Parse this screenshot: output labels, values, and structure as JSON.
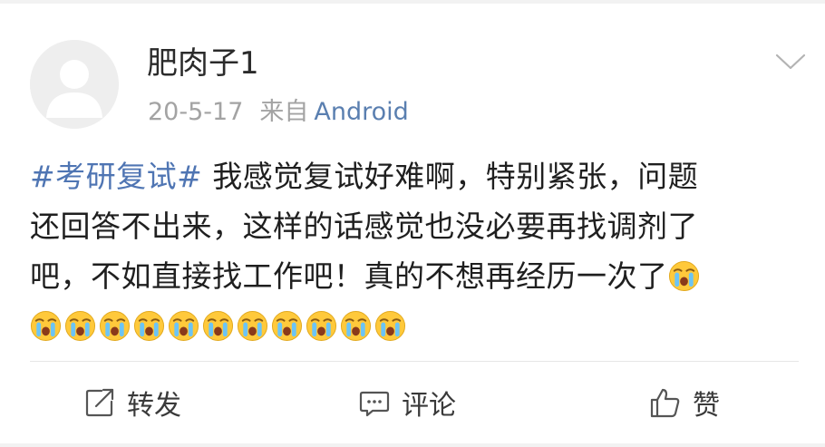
{
  "post": {
    "username": "肥肉子1",
    "date": "20-5-17",
    "from_label": "来自",
    "source": "Android",
    "hashtag": "#考研复试#",
    "text_line1": " 我感觉复试好难啊，特别紧张，问题",
    "text_line2": "还回答不出来，这样的话感觉也没必要再找调剂了",
    "text_line3": "吧，不如直接找工作吧！真的不想再经历一次了",
    "emoji_name": "crying-face-emoji",
    "emoji_count_trailing": 11
  },
  "actions": {
    "repost_label": "转发",
    "comment_label": "评论",
    "like_label": "赞"
  },
  "colors": {
    "hashtag": "#4f75b3",
    "source": "#5a7fb0",
    "meta": "#a3a3a3",
    "text": "#1f1f1f"
  },
  "icons": [
    "default-avatar-icon",
    "chevron-down-icon",
    "repost-icon",
    "comment-icon",
    "thumbs-up-icon"
  ]
}
